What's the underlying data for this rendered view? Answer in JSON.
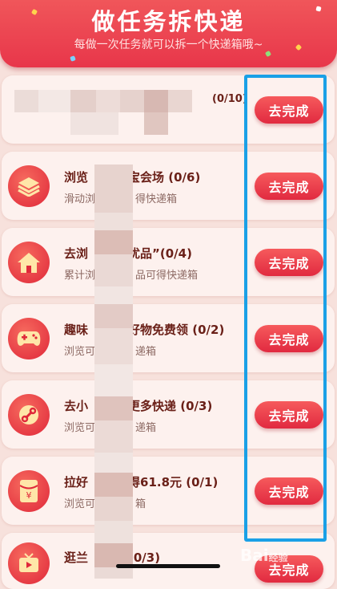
{
  "header": {
    "title": "做任务拆快递",
    "subtitle": "每做一次任务就可以拆一个快递箱哦~"
  },
  "tasks": [
    {
      "title": "",
      "progress": "(0/10)",
      "desc": "",
      "button": "去完成",
      "icon": "hidden"
    },
    {
      "title": "浏览",
      "title_tail": "宝会场 (0/6)",
      "desc": "滑动浏",
      "desc_tail": "得快递箱",
      "button": "去完成",
      "icon": "layers-icon"
    },
    {
      "title": "去浏",
      "title_tail": "优品”(0/4)",
      "desc": "累计浏",
      "desc_tail": "品可得快递箱",
      "button": "去完成",
      "icon": "home-icon"
    },
    {
      "title": "趣味",
      "title_tail": "好物免费领 (0/2)",
      "desc": "浏览可",
      "desc_tail": "递箱",
      "button": "去完成",
      "icon": "gamepad-icon"
    },
    {
      "title": "去小",
      "title_tail": "更多快递 (0/3)",
      "desc": "浏览可",
      "desc_tail": "递箱",
      "button": "去完成",
      "icon": "link-icon"
    },
    {
      "title": "拉好",
      "title_tail": "得61.8元 (0/1)",
      "desc": "浏览可",
      "desc_tail": "箱",
      "button": "去完成",
      "icon": "red-envelope-icon"
    },
    {
      "title": "逛兰",
      "title_tail": "(0/3)",
      "desc": "",
      "desc_tail": "",
      "button": "去完成",
      "icon": "tv-icon"
    }
  ],
  "watermark": {
    "text": "Bai",
    "suffix": "经验"
  },
  "colors": {
    "accent": "#e8364a",
    "highlight": "#1aa0e6",
    "card": "#fdf1ee"
  }
}
